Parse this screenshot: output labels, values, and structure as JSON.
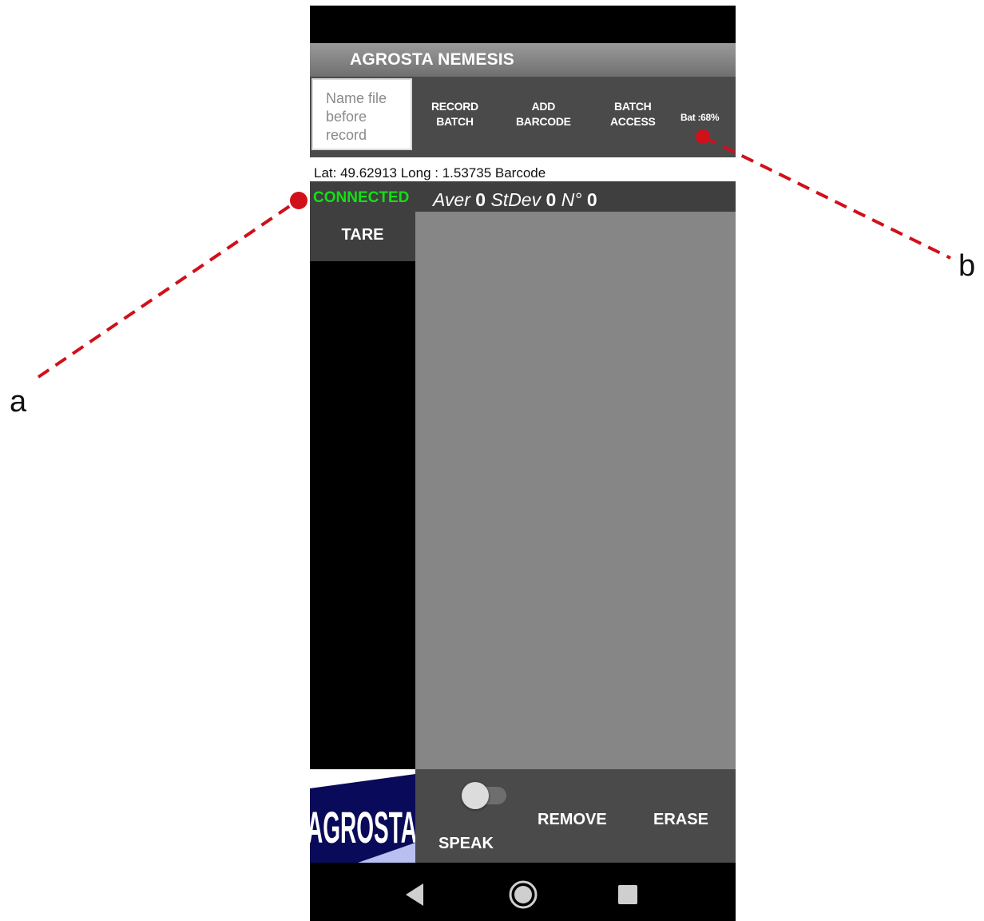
{
  "app": {
    "title": "AGROSTA NEMESIS"
  },
  "toolbar": {
    "name_placeholder": "Name file\nbefore\nrecord",
    "record_batch": "RECORD\nBATCH",
    "add_barcode": "ADD\nBARCODE",
    "batch_access": "BATCH\nACCESS",
    "battery": "Bat :68%"
  },
  "info": {
    "coords": "Lat: 49.62913  Long : 1.53735  Barcode"
  },
  "stats": {
    "connection_status": "CONNECTED",
    "aver_label": "Aver",
    "aver_value": "0",
    "stdev_label": "StDev",
    "stdev_value": "0",
    "n_label": "N°",
    "n_value": "0"
  },
  "buttons": {
    "tare": "TARE",
    "speak": "SPEAK",
    "remove": "REMOVE",
    "erase": "ERASE"
  },
  "logo": {
    "text": "AGROSTA"
  },
  "annotations": {
    "a": "a",
    "b": "b"
  },
  "colors": {
    "connected": "#14e014",
    "annotation": "#d0101a",
    "chart_bg": "#868686",
    "bar_bg": "#4a4a4a"
  },
  "speak_toggle": {
    "on": false
  }
}
